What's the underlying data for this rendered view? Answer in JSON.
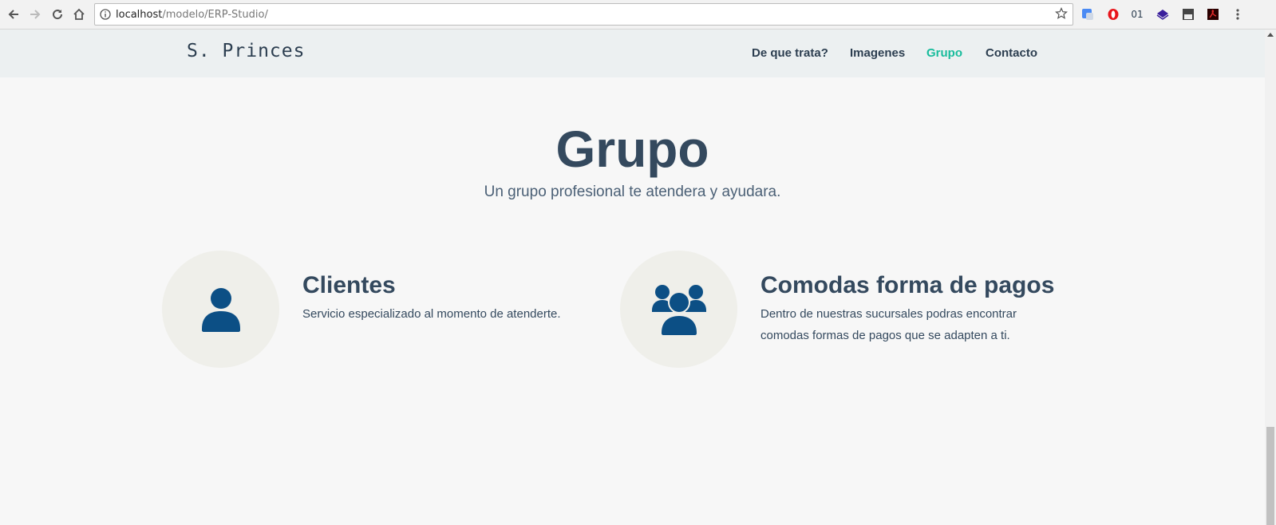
{
  "browser": {
    "url_host": "localhost",
    "url_path": "/modelo/ERP-Studio/",
    "ext_label_01": "01"
  },
  "navbar": {
    "brand": "S. Princes",
    "items": [
      {
        "label": "De que trata?",
        "active": false
      },
      {
        "label": "Imagenes",
        "active": false
      },
      {
        "label": "Grupo",
        "active": true
      },
      {
        "label": "Contacto",
        "active": false
      }
    ]
  },
  "section": {
    "title": "Grupo",
    "subtitle": "Un grupo profesional te atendera y ayudara."
  },
  "features": [
    {
      "icon": "user-icon",
      "title": "Clientes",
      "text": "Servicio especializado al momento de atenderte."
    },
    {
      "icon": "users-icon",
      "title": "Comodas forma de pagos",
      "text": "Dentro de nuestras sucursales podras encontrar comodas formas de pagos que se adapten a ti."
    }
  ],
  "colors": {
    "accent": "#18bc9c",
    "primary": "#2c3e50",
    "icon": "#0c4f85"
  }
}
